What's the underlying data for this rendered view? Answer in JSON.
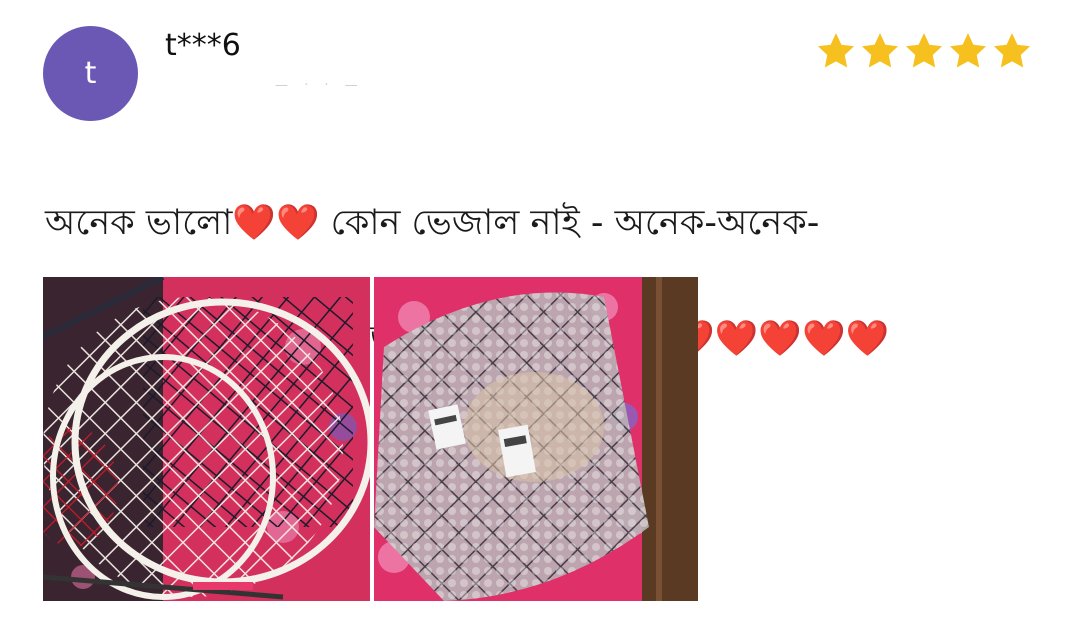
{
  "review": {
    "avatar_letter": "t",
    "username": "t***6",
    "meta_text": "— · · —",
    "rating": 5,
    "rating_max": 5,
    "text_line_1": "অনেক ভালো❤️❤️  কোন ভেজাল নাই - অনেক-অনেক-",
    "text_line_2": "অনেক অনেক- অনেক 'ভালো 😍🤩😀❤️❤️❤️❤️❤️❤️❤️",
    "photos": [
      {
        "alt": "basketball-net-photo"
      },
      {
        "alt": "packaged-product-photo"
      }
    ]
  },
  "colors": {
    "avatar_bg": "#6b58b5",
    "star_fill": "#f6c11e",
    "text": "#1a1a1a"
  }
}
